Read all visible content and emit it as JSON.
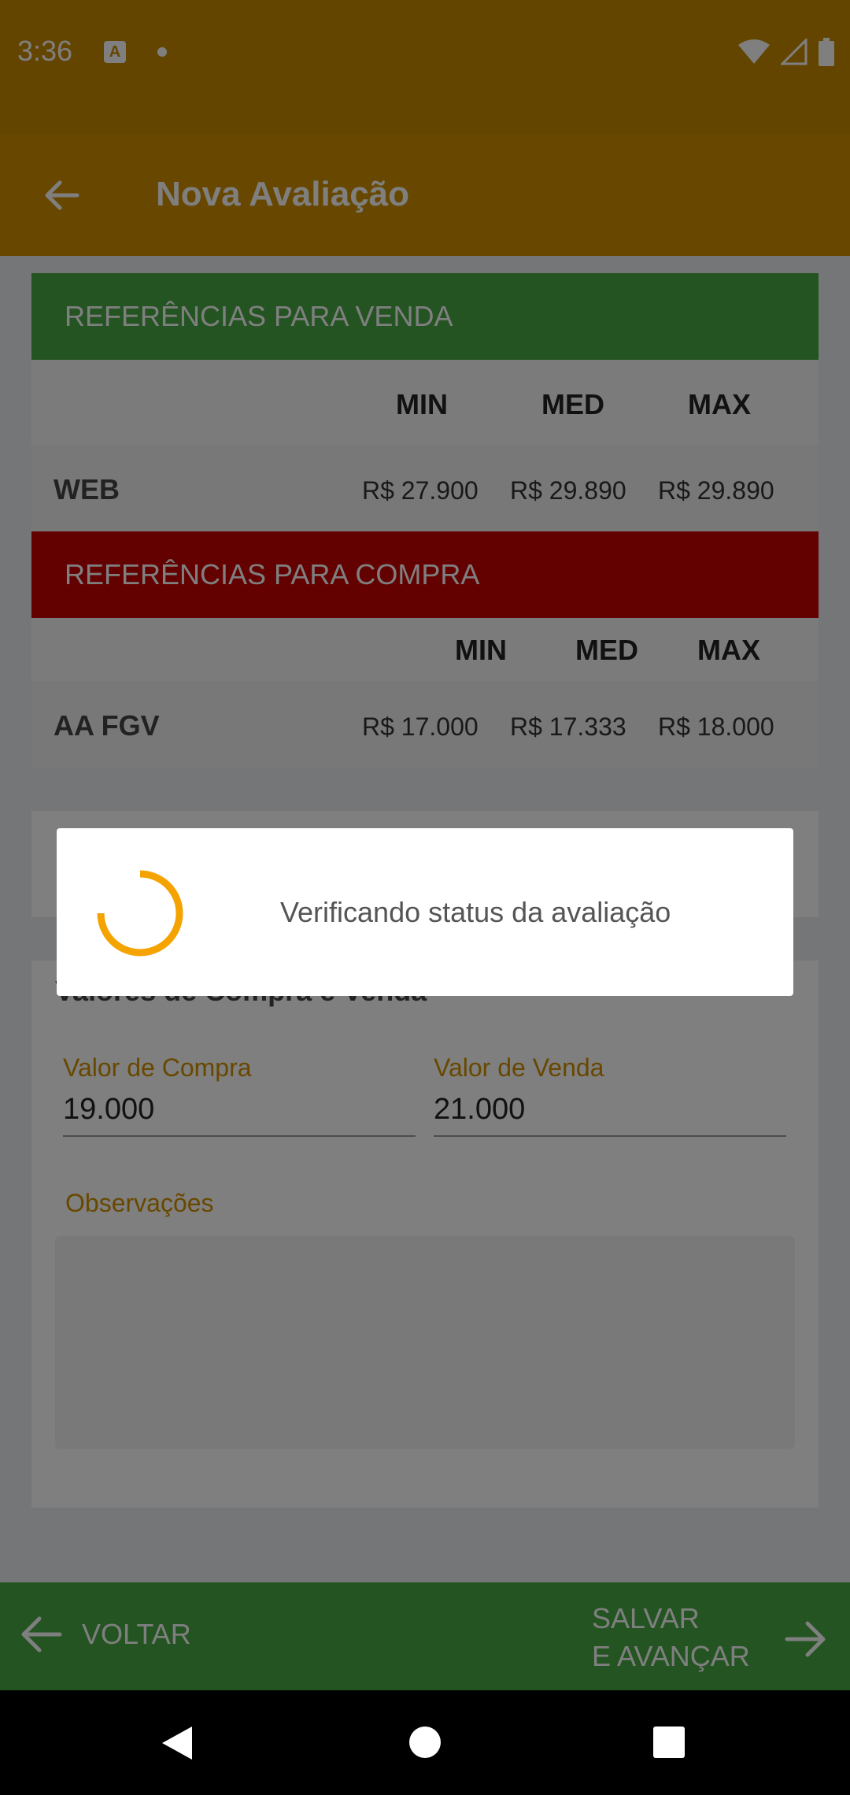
{
  "status_bar": {
    "time": "3:36",
    "notif_letter": "A"
  },
  "app_bar": {
    "title": "Nova Avaliação"
  },
  "ref_sale": {
    "header": "REFERÊNCIAS PARA VENDA",
    "cols": [
      "MIN",
      "MED",
      "MAX"
    ],
    "row": {
      "label": "WEB",
      "values": [
        "R$  27.900",
        "R$  29.890",
        "R$  29.890"
      ]
    }
  },
  "ref_buy": {
    "header": "REFERÊNCIAS PARA COMPRA",
    "cols": [
      "MIN",
      "MED",
      "MAX"
    ],
    "row": {
      "label": "AA FGV",
      "values": [
        "R$  17.000",
        "R$  17.333",
        "R$  18.000"
      ]
    }
  },
  "values_card": {
    "title": "Valores de Compra e Venda",
    "buy_label": "Valor de Compra",
    "buy_value": "19.000",
    "sale_label": "Valor de Venda",
    "sale_value": "21.000",
    "obs_label": "Observações"
  },
  "actions": {
    "back_label": "VOLTAR",
    "next_label": "SALVAR\nE AVANÇAR"
  },
  "dialog": {
    "message": "Verificando status da avaliação"
  },
  "colors": {
    "accent": "#d19000",
    "sale": "#46a843",
    "buy": "#c70000",
    "spinner": "#f5a300"
  }
}
